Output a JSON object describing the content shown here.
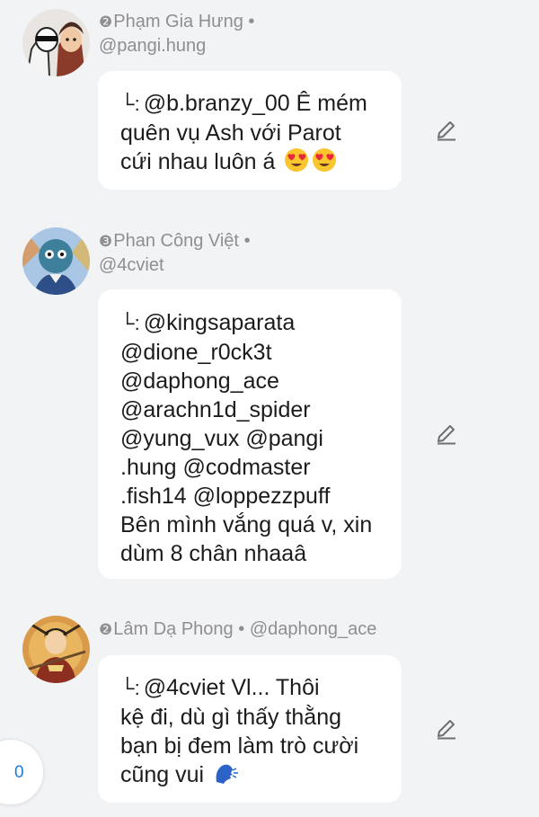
{
  "comments": [
    {
      "rank": "❷",
      "name": "Phạm Gia Hưng",
      "separator": "•",
      "handle": "@pangi.hung",
      "lines": [
        "@b.branzy_00 Ê mém",
        "quên vụ Ash với Parot",
        "cứi nhau luôn á"
      ],
      "reply_glyph": "└:",
      "emojis": [
        "heart-eyes",
        "heart-eyes"
      ]
    },
    {
      "rank": "❸",
      "name": "Phan Công Việt",
      "separator": "•",
      "handle": "@4cviet",
      "lines": [
        "@kingsaparata",
        "@dione_r0ck3t",
        "@daphong_ace",
        "@arachn1d_spider",
        "@yung_vux @pangi",
        ".hung @codmaster",
        ".fish14 @loppezzpuff",
        "Bên mình vắng quá v, xin",
        "dùm 8 chân nhaaâ"
      ],
      "reply_glyph": "└:"
    },
    {
      "rank": "❷",
      "name": "Lâm Dạ Phong",
      "separator": "•",
      "handle": "@daphong_ace",
      "lines": [
        "@4cviet Vl... Thôi",
        "kệ đi, dù gì thấy thằng",
        "bạn bị đem làm trò cười",
        "cũng vui"
      ],
      "reply_glyph": "└:",
      "emojis": [
        "speaking-head"
      ]
    }
  ],
  "fab": {
    "count": "0"
  },
  "colors": {
    "background": "#f2f3f5",
    "bubble": "#ffffff",
    "meta": "#8e8e93",
    "accent": "#1f7ae0"
  },
  "icons": {
    "edit": "pencil-icon"
  }
}
